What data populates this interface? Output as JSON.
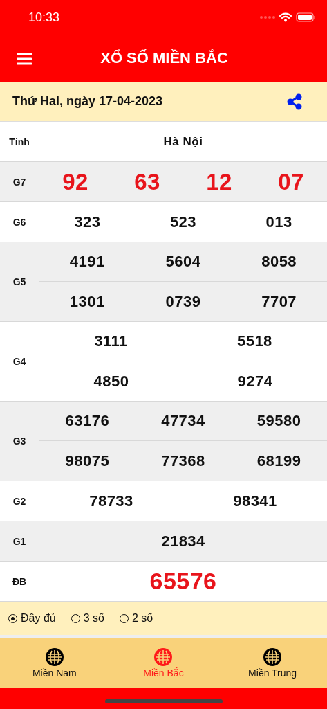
{
  "status_bar": {
    "time": "10:33"
  },
  "header": {
    "title": "XỔ SỐ MIỀN BẮC"
  },
  "date_bar": {
    "date": "Thứ Hai, ngày 17-04-2023"
  },
  "table": {
    "rows": [
      {
        "label": "Tỉnh",
        "kind": "province",
        "lines": [
          [
            "Hà Nội"
          ]
        ]
      },
      {
        "label": "G7",
        "kind": "red",
        "lines": [
          [
            "92",
            "63",
            "12",
            "07"
          ]
        ]
      },
      {
        "label": "G6",
        "kind": "normal",
        "lines": [
          [
            "323",
            "523",
            "013"
          ]
        ]
      },
      {
        "label": "G5",
        "kind": "normal",
        "lines": [
          [
            "4191",
            "5604",
            "8058"
          ],
          [
            "1301",
            "0739",
            "7707"
          ]
        ]
      },
      {
        "label": "G4",
        "kind": "normal",
        "lines": [
          [
            "3111",
            "5518"
          ],
          [
            "4850",
            "9274"
          ]
        ]
      },
      {
        "label": "G3",
        "kind": "normal",
        "lines": [
          [
            "63176",
            "47734",
            "59580"
          ],
          [
            "98075",
            "77368",
            "68199"
          ]
        ]
      },
      {
        "label": "G2",
        "kind": "normal",
        "lines": [
          [
            "78733",
            "98341"
          ]
        ]
      },
      {
        "label": "G1",
        "kind": "normal",
        "lines": [
          [
            "21834"
          ]
        ]
      },
      {
        "label": "ĐB",
        "kind": "special",
        "lines": [
          [
            "65576"
          ]
        ]
      }
    ]
  },
  "options": [
    {
      "label": "Đầy đủ",
      "selected": true
    },
    {
      "label": "3 số",
      "selected": false
    },
    {
      "label": "2 số",
      "selected": false
    }
  ],
  "tabs": [
    {
      "label": "Miền Nam",
      "selected": false
    },
    {
      "label": "Miền Bắc",
      "selected": true
    },
    {
      "label": "Miền Trung",
      "selected": false
    }
  ]
}
